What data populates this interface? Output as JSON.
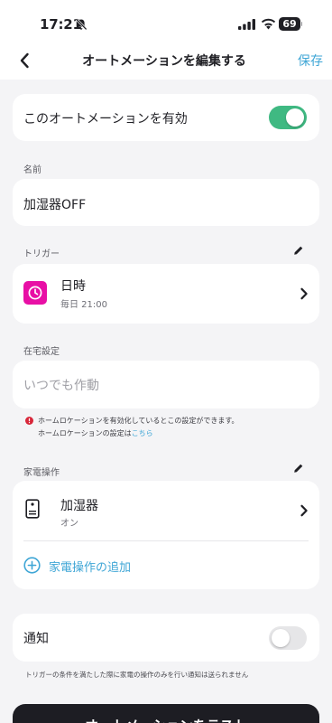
{
  "status_bar": {
    "time": "17:21",
    "battery_level": "69"
  },
  "nav": {
    "title": "オートメーションを編集する",
    "save_label": "保存"
  },
  "enable_card": {
    "label": "このオートメーションを有効",
    "enabled": true
  },
  "name_section": {
    "label": "名前",
    "value": "加湿器OFF"
  },
  "trigger_section": {
    "label": "トリガー",
    "item_title": "日時",
    "item_subtitle": "毎日 21:00"
  },
  "presence_section": {
    "label": "在宅設定",
    "placeholder": "いつでも作動",
    "notice_line1": "ホームロケーションを有効化しているとこの設定ができます。",
    "notice_line2": "ホームロケーションの設定は",
    "notice_link": "こちら"
  },
  "appliance_section": {
    "label": "家電操作",
    "item_title": "加湿器",
    "item_subtitle": "オン",
    "add_label": "家電操作の追加"
  },
  "notify_card": {
    "label": "通知",
    "enabled": false,
    "note": "トリガーの条件を満たした際に家電の操作のみを行い通知は送られません"
  },
  "footer": {
    "test_button_label": "オートメーションをテスト"
  },
  "colors": {
    "accent_blue": "#3fa6d6",
    "toggle_green": "#3fb982",
    "trigger_icon_magenta": "#e80fa5",
    "alert_red": "#d8273a"
  }
}
